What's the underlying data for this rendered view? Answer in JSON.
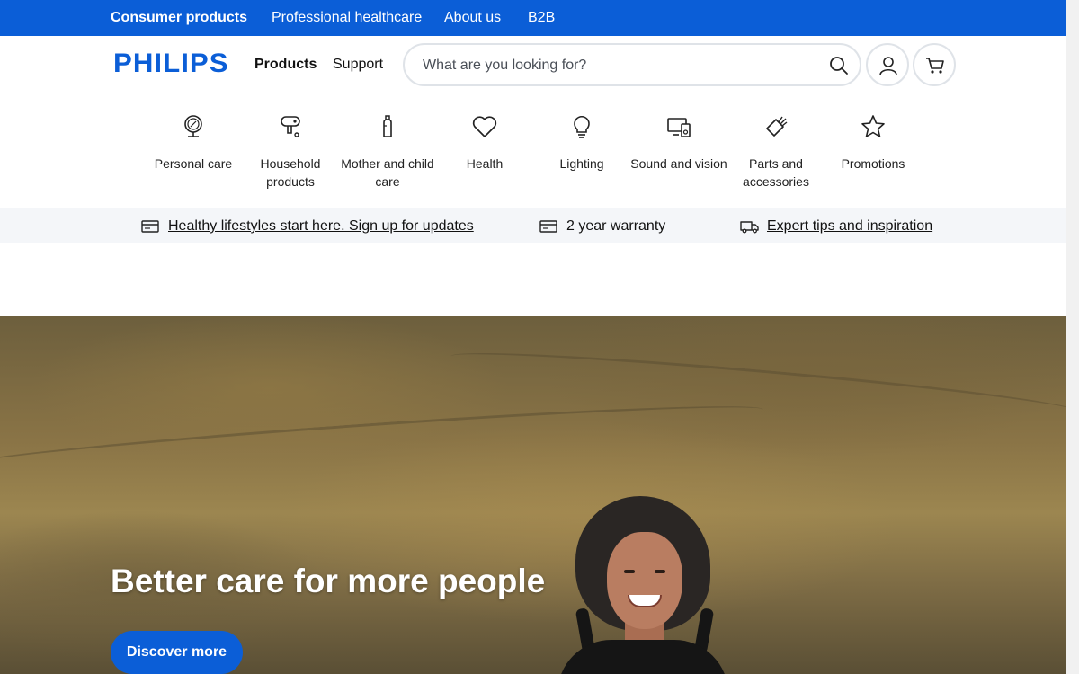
{
  "topbar": {
    "links": [
      {
        "label": "Consumer products",
        "active": true
      },
      {
        "label": "Professional healthcare",
        "active": false
      },
      {
        "label": "About us",
        "active": false
      },
      {
        "label": "B2B",
        "active": false
      }
    ]
  },
  "header": {
    "logo": "PHILIPS",
    "nav": {
      "products": "Products",
      "support": "Support"
    },
    "search": {
      "placeholder": "What are you looking for?",
      "value": ""
    }
  },
  "categories": [
    {
      "label": "Personal care",
      "icon": "mirror-icon"
    },
    {
      "label": "Household products",
      "icon": "iron-icon"
    },
    {
      "label": "Mother and child care",
      "icon": "baby-bottle-icon"
    },
    {
      "label": "Health",
      "icon": "heart-icon"
    },
    {
      "label": "Lighting",
      "icon": "lightbulb-icon"
    },
    {
      "label": "Sound and vision",
      "icon": "monitor-speaker-icon"
    },
    {
      "label": "Parts and accessories",
      "icon": "accessory-brush-icon"
    },
    {
      "label": "Promotions",
      "icon": "star-icon"
    }
  ],
  "benefits": [
    {
      "label": "Healthy lifestyles start here. Sign up for updates",
      "icon": "card-icon",
      "link": true
    },
    {
      "label": "2 year warranty",
      "icon": "card-icon",
      "link": false
    },
    {
      "label": "Expert tips and inspiration",
      "icon": "truck-icon",
      "link": true
    }
  ],
  "hero": {
    "title": "Better care for more people",
    "cta": "Discover more"
  },
  "colors": {
    "brand": "#0b5ed7",
    "benefits_bg": "#f4f6f9"
  }
}
